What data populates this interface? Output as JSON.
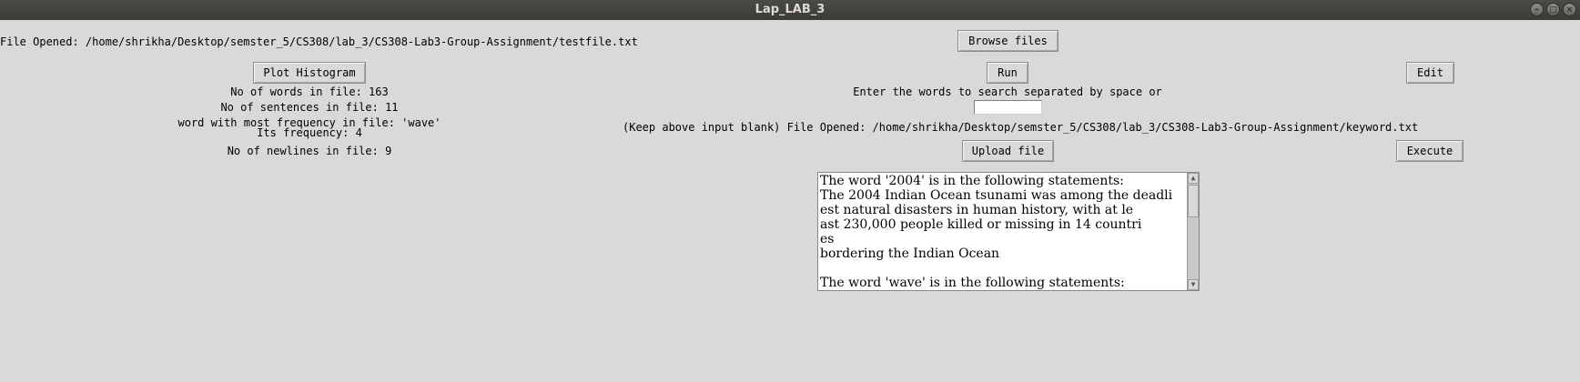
{
  "window": {
    "title": "Lap_LAB_3",
    "controls": [
      "–",
      "□",
      "×"
    ]
  },
  "left": {
    "file_opened": "File Opened: /home/shrikha/Desktop/semster_5/CS308/lab_3/CS308-Lab3-Group-Assignment/testfile.txt",
    "plot_histogram": "Plot Histogram",
    "words": "No of words in file: 163",
    "sentences": "No of sentences in file: 11",
    "most_freq_word": "word with most frequency in file: 'wave'",
    "its_frequency": "Its frequency: 4",
    "newlines": "No of newlines in file: 9"
  },
  "middle": {
    "browse_files": "Browse files",
    "run": "Run",
    "enter_words": "Enter the words to search separated by space or",
    "search_value": "",
    "keyword_file": "(Keep above input blank) File Opened: /home/shrikha/Desktop/semster_5/CS308/lab_3/CS308-Lab3-Group-Assignment/keyword.txt",
    "upload_file": "Upload file"
  },
  "right": {
    "edit": "Edit",
    "execute": "Execute"
  },
  "output": {
    "lines": [
      "The word '2004' is in the following statements:",
      "The 2004 Indian Ocean tsunami was among the deadli",
      "est natural disasters in human history, with at le",
      "ast 230,000 people killed or missing in 14 countri",
      "es",
      "bordering the Indian Ocean",
      "",
      "The word 'wave' is in the following statements:"
    ]
  }
}
